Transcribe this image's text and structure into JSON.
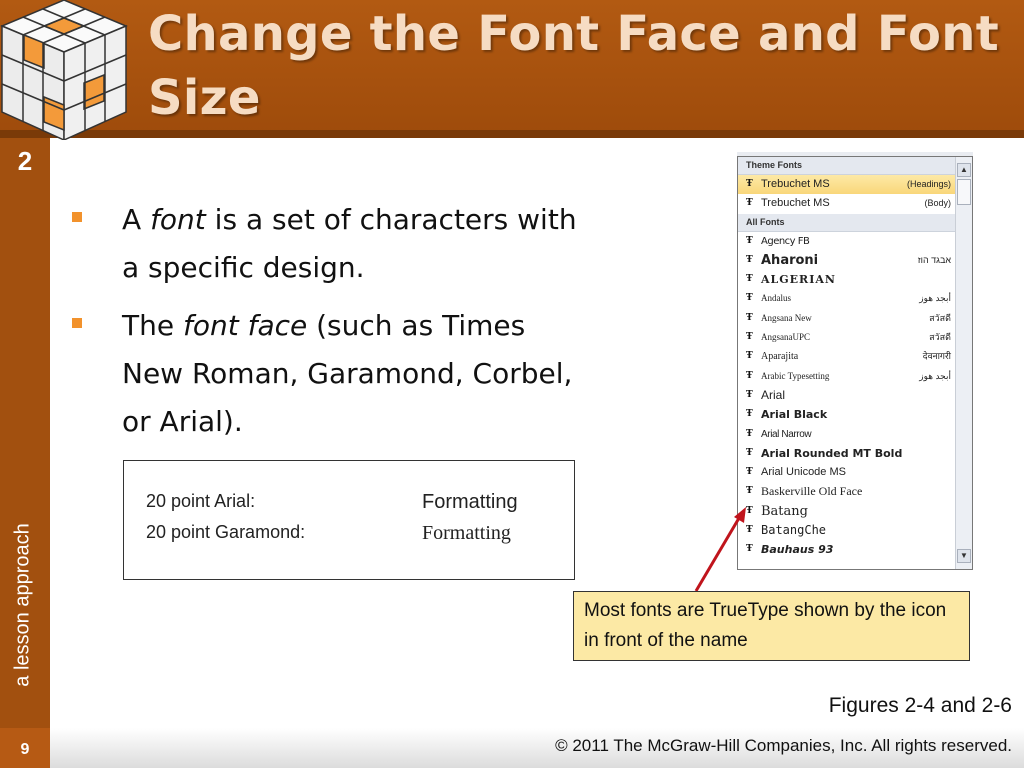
{
  "slide": {
    "title": "Change the Font Face and Font Size",
    "chapter_number": "2",
    "tagline": "a lesson approach",
    "page_number": "9",
    "copyright": "© 2011 The McGraw-Hill Companies, Inc. All rights reserved.",
    "figures_caption": "Figures 2-4 and 2-6"
  },
  "bullets": [
    {
      "pre": "A ",
      "em": "font",
      "post": " is a set of characters with a specific design."
    },
    {
      "pre": "The ",
      "em": "font face",
      "post": " (such as Times New Roman, Garamond, Corbel, or Arial)."
    }
  ],
  "sample": {
    "rows": [
      {
        "label": "20 point Arial:",
        "value": "Formatting"
      },
      {
        "label": "20 point Garamond:",
        "value": "Formatting"
      }
    ]
  },
  "font_list": {
    "theme_header": "Theme Fonts",
    "all_header": "All Fonts",
    "truetype_glyph": "Ŧ",
    "theme_fonts": [
      {
        "name": "Trebuchet MS",
        "right": "(Headings)",
        "selected": true
      },
      {
        "name": "Trebuchet MS",
        "right": "(Body)",
        "selected": false
      }
    ],
    "all_fonts": [
      {
        "name": "Agency FB",
        "right": ""
      },
      {
        "name": "Aharoni",
        "right": "אבגד הוז"
      },
      {
        "name": "ALGERIAN",
        "right": ""
      },
      {
        "name": "Andalus",
        "right": "أبجد هوز"
      },
      {
        "name": "Angsana New",
        "right": "สวัสดี"
      },
      {
        "name": "AngsanaUPC",
        "right": "สวัสดี"
      },
      {
        "name": "Aparajita",
        "right": "देवनागरी"
      },
      {
        "name": "Arabic Typesetting",
        "right": "أبجد هوز"
      },
      {
        "name": "Arial",
        "right": ""
      },
      {
        "name": "Arial Black",
        "right": ""
      },
      {
        "name": "Arial Narrow",
        "right": ""
      },
      {
        "name": "Arial Rounded MT Bold",
        "right": ""
      },
      {
        "name": "Arial Unicode MS",
        "right": ""
      },
      {
        "name": "Baskerville Old Face",
        "right": ""
      },
      {
        "name": "Batang",
        "right": ""
      },
      {
        "name": "BatangChe",
        "right": ""
      },
      {
        "name": "Bauhaus 93",
        "right": ""
      }
    ]
  },
  "callout": {
    "text": "Most fonts are TrueType shown by the icon in front of the name"
  },
  "colors": {
    "header": "#a5520f",
    "bullet": "#f2922c",
    "callout_bg": "#fce9a5",
    "arrow": "#c0141c"
  }
}
